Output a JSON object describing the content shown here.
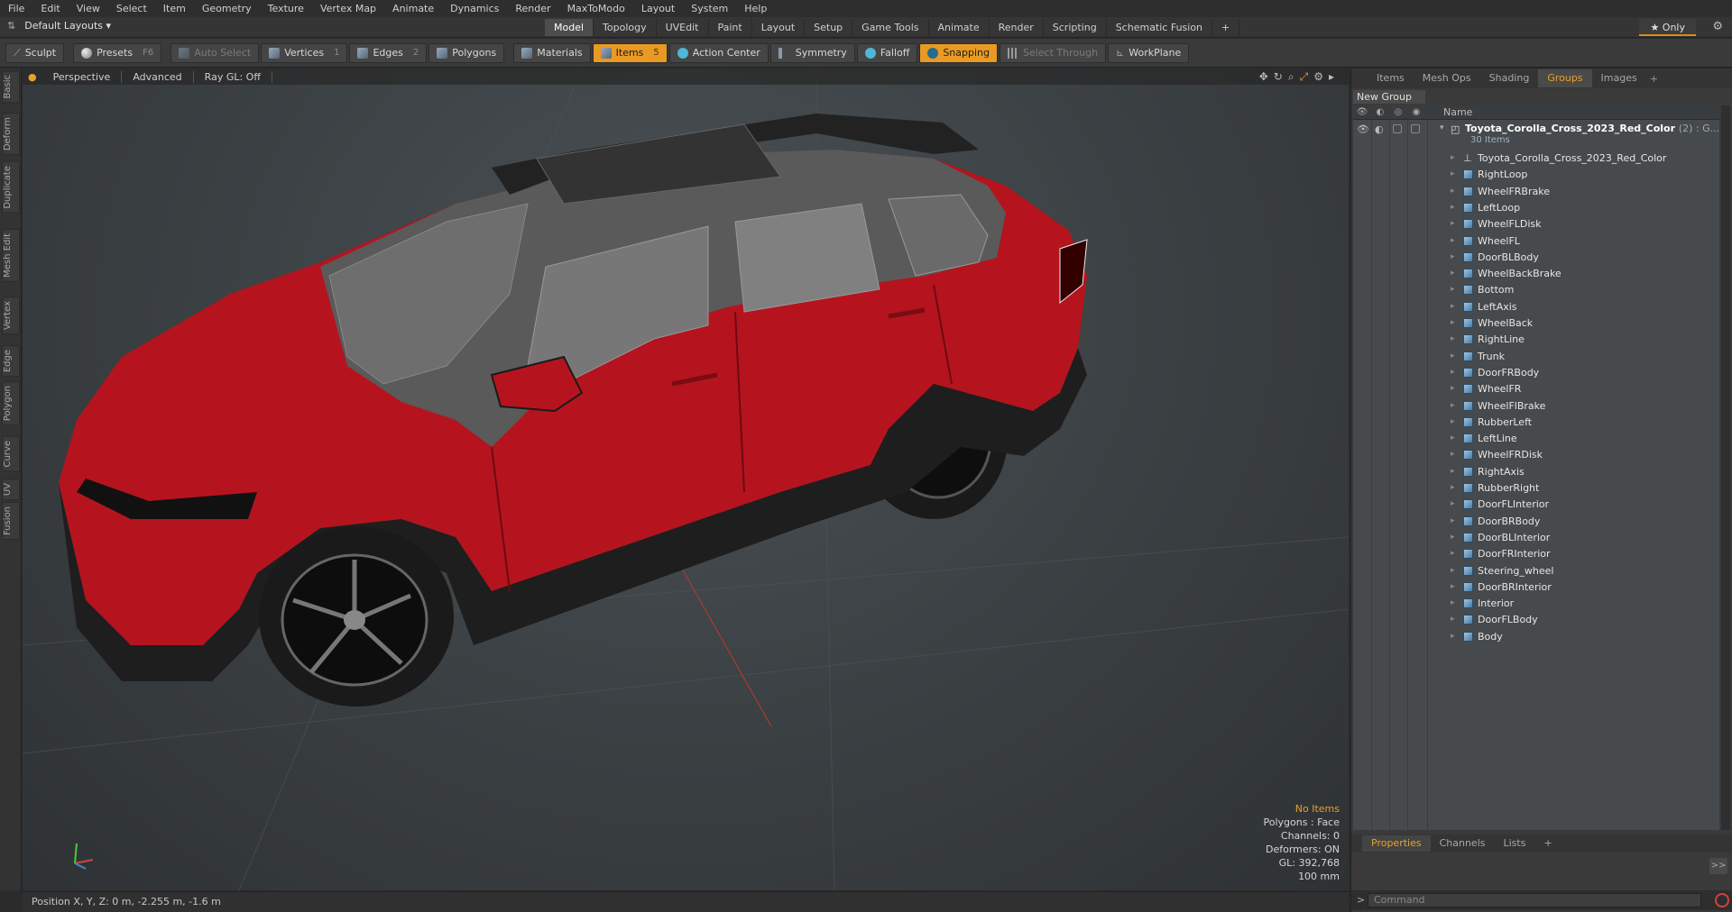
{
  "menu": [
    "File",
    "Edit",
    "View",
    "Select",
    "Item",
    "Geometry",
    "Texture",
    "Vertex Map",
    "Animate",
    "Dynamics",
    "Render",
    "MaxToModo",
    "Layout",
    "System",
    "Help"
  ],
  "layout_selector": "Default Layouts ▾",
  "layout_tabs": [
    {
      "label": "Model",
      "active": true
    },
    {
      "label": "Topology"
    },
    {
      "label": "UVEdit"
    },
    {
      "label": "Paint"
    },
    {
      "label": "Layout"
    },
    {
      "label": "Setup"
    },
    {
      "label": "Game Tools"
    },
    {
      "label": "Animate"
    },
    {
      "label": "Render"
    },
    {
      "label": "Scripting"
    },
    {
      "label": "Schematic Fusion"
    }
  ],
  "layout_add": "+",
  "only_label": "★ Only",
  "toolbar": {
    "sculpt": "Sculpt",
    "presets": "Presets",
    "presets_key": "F6",
    "auto_select": "Auto Select",
    "vertices": "Vertices",
    "vertices_count": "1",
    "edges": "Edges",
    "edges_count": "2",
    "polygons": "Polygons",
    "materials": "Materials",
    "items": "Items",
    "items_count": "5",
    "action_center": "Action Center",
    "symmetry": "Symmetry",
    "falloff": "Falloff",
    "snapping": "Snapping",
    "select_through": "Select Through",
    "workplane": "WorkPlane"
  },
  "left_tabs": [
    "Basic",
    "Deform",
    "Duplicate",
    "Mesh Edit",
    "Vertex",
    "Edge",
    "Polygon",
    "Curve",
    "UV",
    "Fusion"
  ],
  "viewport": {
    "view": "Perspective",
    "mode": "Advanced",
    "raygl": "Ray GL: Off",
    "info": {
      "selection": "No Items",
      "polygons": "Polygons : Face",
      "channels": "Channels: 0",
      "deformers": "Deformers: ON",
      "gl": "GL: 392,768",
      "scale": "100 mm"
    }
  },
  "status": "Position X, Y, Z:  0 m, -2.255 m, -1.6 m",
  "right_panel": {
    "tabs": [
      {
        "label": "Items"
      },
      {
        "label": "Mesh Ops"
      },
      {
        "label": "Shading"
      },
      {
        "label": "Groups",
        "active": true
      },
      {
        "label": "Images"
      }
    ],
    "tab_add": "+",
    "new_group": "New Group",
    "name_header": "Name",
    "group": {
      "name": "Toyota_Corolla_Cross_2023_Red_Color",
      "suffix": "(2) : G...",
      "count": "30 Items"
    },
    "items": [
      {
        "name": "Toyota_Corolla_Cross_2023_Red_Color",
        "type": "locator"
      },
      {
        "name": "RightLoop"
      },
      {
        "name": "WheelFRBrake"
      },
      {
        "name": "LeftLoop"
      },
      {
        "name": "WheelFLDisk"
      },
      {
        "name": "WheelFL"
      },
      {
        "name": "DoorBLBody"
      },
      {
        "name": "WheelBackBrake"
      },
      {
        "name": "Bottom"
      },
      {
        "name": "LeftAxis"
      },
      {
        "name": "WheelBack"
      },
      {
        "name": "RightLine"
      },
      {
        "name": "Trunk"
      },
      {
        "name": "DoorFRBody"
      },
      {
        "name": "WheelFR"
      },
      {
        "name": "WheelFlBrake"
      },
      {
        "name": "RubberLeft"
      },
      {
        "name": "LeftLine"
      },
      {
        "name": "WheelFRDisk"
      },
      {
        "name": "RightAxis"
      },
      {
        "name": "RubberRight"
      },
      {
        "name": "DoorFLInterior"
      },
      {
        "name": "DoorBRBody"
      },
      {
        "name": "DoorBLInterior"
      },
      {
        "name": "DoorFRInterior"
      },
      {
        "name": "Steering_wheel"
      },
      {
        "name": "DoorBRInterior"
      },
      {
        "name": "Interior"
      },
      {
        "name": "DoorFLBody"
      },
      {
        "name": "Body"
      }
    ],
    "bottom_tabs": [
      {
        "label": "Properties",
        "active": true
      },
      {
        "label": "Channels"
      },
      {
        "label": "Lists"
      }
    ],
    "bottom_add": "+",
    "expand": ">>",
    "command_prompt": ">",
    "command_placeholder": "Command"
  },
  "colors": {
    "accent": "#e89a23",
    "car_red": "#b5141e",
    "viewport_bg": "#3a3f42"
  }
}
